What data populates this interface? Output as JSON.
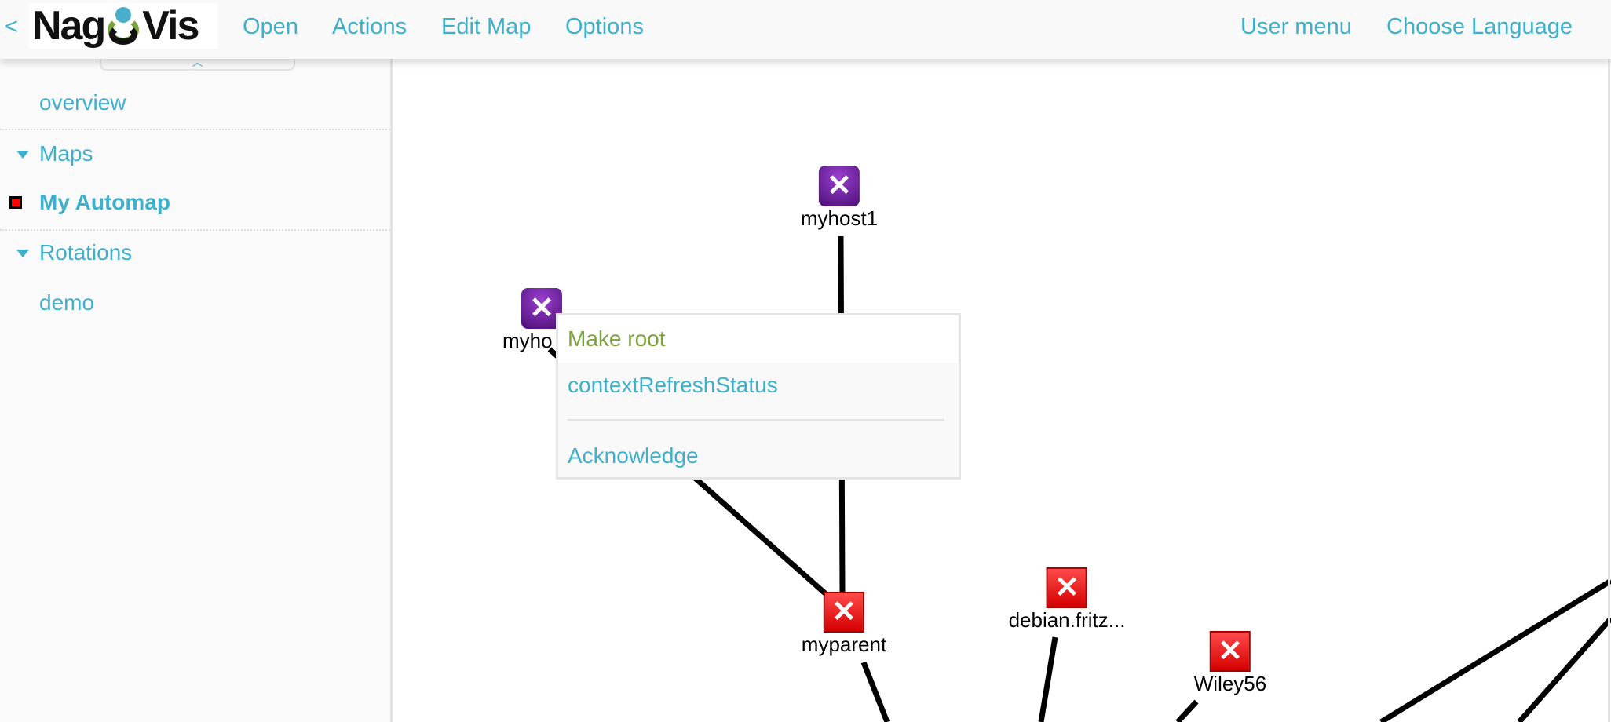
{
  "header": {
    "back": "<",
    "logo": "NagVis",
    "menu": [
      "Open",
      "Actions",
      "Edit Map",
      "Options"
    ],
    "right": [
      "User menu",
      "Choose Language"
    ]
  },
  "sidebar": {
    "overview": "overview",
    "maps_heading": "Maps",
    "maps": [
      "My Automap"
    ],
    "active_map_status_color": "#ff0000",
    "rotations_heading": "Rotations",
    "rotations": [
      "demo"
    ]
  },
  "map": {
    "nodes": [
      {
        "label": "myhost1",
        "state": "unreachable",
        "color": "#6a1fa0"
      },
      {
        "label": "myho",
        "state": "unreachable",
        "color": "#6a1fa0"
      },
      {
        "label": "myparent",
        "state": "down",
        "color": "#e00000"
      },
      {
        "label": "debian.fritz...",
        "state": "down",
        "color": "#e00000"
      },
      {
        "label": "Wiley56",
        "state": "down",
        "color": "#e00000"
      }
    ]
  },
  "context_menu": {
    "items": [
      "Make root",
      "contextRefreshStatus",
      "Acknowledge"
    ],
    "highlight_color": "#7aa33a"
  },
  "colors": {
    "accent": "#3fb0cc"
  }
}
